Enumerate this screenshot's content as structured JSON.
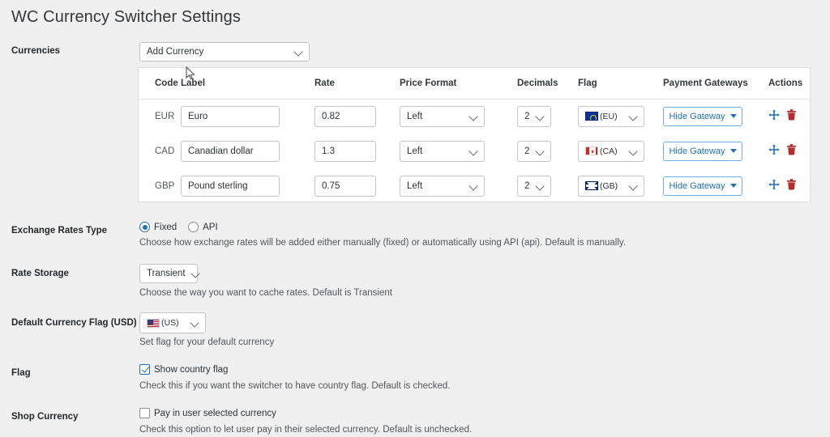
{
  "page": {
    "title": "WC Currency Switcher Settings",
    "background_color": "#f0f0f1"
  },
  "add_currency": {
    "label": "Add Currency",
    "caret_icon": "chevron-down-icon"
  },
  "currencies_row": {
    "label": "Currencies"
  },
  "currencies_table": {
    "columns": [
      "Code",
      "Label",
      "Rate",
      "Price Format",
      "Decimals",
      "Flag",
      "Payment Gateways",
      "Actions"
    ],
    "rows": [
      {
        "code": "EUR",
        "label": "Euro",
        "rate": "0.82",
        "price_format": "Left",
        "decimals": "2",
        "flag_code": "(EU)",
        "flag_icon": "flag-eu-icon",
        "gateway_label": "Hide Gateway",
        "move_icon": "move-icon",
        "delete_icon": "trash-icon"
      },
      {
        "code": "CAD",
        "label": "Canadian dollar",
        "rate": "1.3",
        "price_format": "Left",
        "decimals": "2",
        "flag_code": "(CA)",
        "flag_icon": "flag-ca-icon",
        "gateway_label": "Hide Gateway",
        "move_icon": "move-icon",
        "delete_icon": "trash-icon"
      },
      {
        "code": "GBP",
        "label": "Pound sterling",
        "rate": "0.75",
        "price_format": "Left",
        "decimals": "2",
        "flag_code": "(GB)",
        "flag_icon": "flag-gb-icon",
        "gateway_label": "Hide Gateway",
        "move_icon": "move-icon",
        "delete_icon": "trash-icon"
      }
    ]
  },
  "exchange_rates_type": {
    "label": "Exchange Rates Type",
    "option_fixed": "Fixed",
    "option_api": "API",
    "selected": "Fixed",
    "help": "Choose how exchange rates will be added either manually (fixed) or automatically using API (api). Default is manually."
  },
  "rate_storage": {
    "label": "Rate Storage",
    "value": "Transient",
    "help": "Choose the way you want to cache rates. Default is Transient"
  },
  "default_currency_flag": {
    "label": "Default Currency Flag (USD)",
    "flag_code": "(US)",
    "flag_icon": "flag-us-icon",
    "help": "Set flag for your default currency"
  },
  "flag_section": {
    "label": "Flag",
    "checkbox_label": "Show country flag",
    "checked": true,
    "help": "Check this if you want the switcher to have country flag. Default is checked."
  },
  "shop_currency": {
    "label": "Shop Currency",
    "checkbox_label": "Pay in user selected currency",
    "checked": false,
    "help": "Check this option to let user pay in their selected currency. Default is unchecked."
  },
  "colors": {
    "accent": "#2271b1",
    "danger": "#b32d2e",
    "border": "#c3c4c7",
    "text": "#3c434a"
  }
}
